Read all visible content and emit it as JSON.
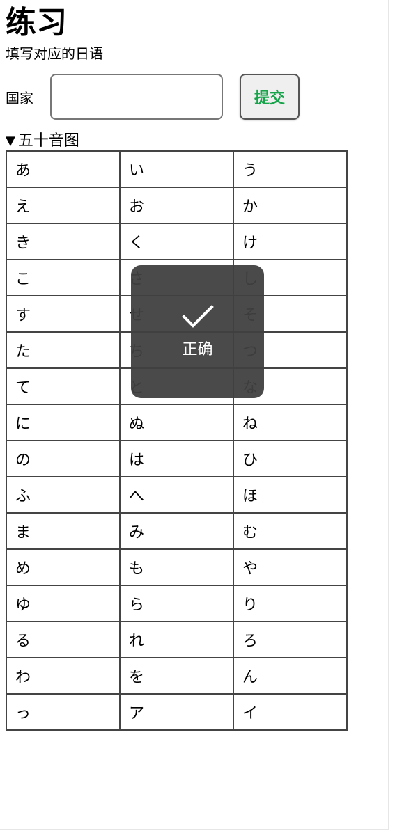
{
  "page": {
    "title": "练习",
    "subtitle": "填写对应的日语"
  },
  "form": {
    "label": "国家",
    "input_value": "",
    "input_placeholder": "",
    "submit_label": "提交"
  },
  "chart_section": {
    "summary_marker": "▼",
    "summary_label": "五十音图",
    "rows": [
      [
        "あ",
        "い",
        "う"
      ],
      [
        "え",
        "お",
        "か"
      ],
      [
        "き",
        "く",
        "け"
      ],
      [
        "こ",
        "さ",
        "し"
      ],
      [
        "す",
        "せ",
        "そ"
      ],
      [
        "た",
        "ち",
        "つ"
      ],
      [
        "て",
        "と",
        "な"
      ],
      [
        "に",
        "ぬ",
        "ね"
      ],
      [
        "の",
        "は",
        "ひ"
      ],
      [
        "ふ",
        "へ",
        "ほ"
      ],
      [
        "ま",
        "み",
        "む"
      ],
      [
        "め",
        "も",
        "や"
      ],
      [
        "ゆ",
        "ら",
        "り"
      ],
      [
        "る",
        "れ",
        "ろ"
      ],
      [
        "わ",
        "を",
        "ん"
      ],
      [
        "っ",
        "ア",
        "イ"
      ]
    ]
  },
  "toast": {
    "icon": "check-icon",
    "text": "正确"
  }
}
